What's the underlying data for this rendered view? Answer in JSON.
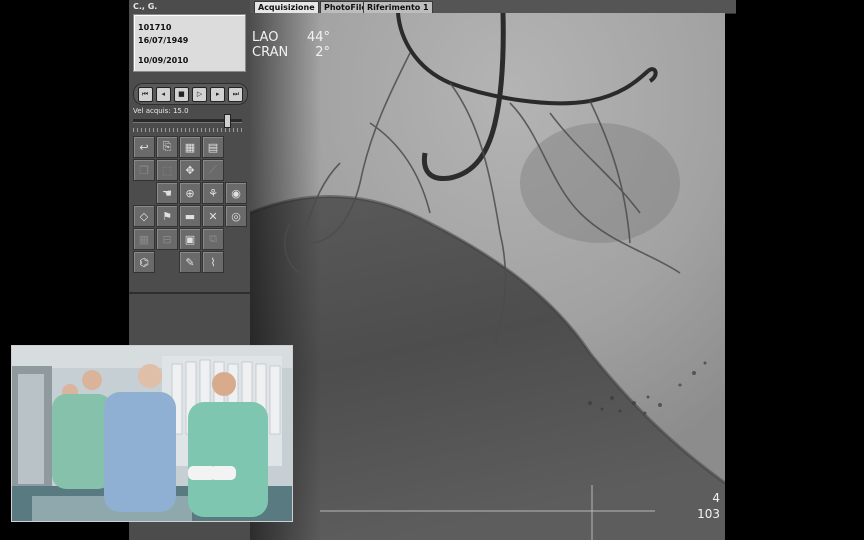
{
  "patient": {
    "name": "C., G.",
    "id": "101710",
    "dob": "16/07/1949",
    "exam_date": "10/09/2010"
  },
  "transport": {
    "buttons": [
      {
        "name": "skip-back-button",
        "icon": "skip-back-icon",
        "glyph": "⏮"
      },
      {
        "name": "step-back-button",
        "icon": "step-back-icon",
        "glyph": "◂"
      },
      {
        "name": "stop-button",
        "icon": "stop-icon",
        "glyph": "■"
      },
      {
        "name": "play-button",
        "icon": "play-icon",
        "glyph": "▷"
      },
      {
        "name": "step-forward-button",
        "icon": "step-forward-icon",
        "glyph": "▸"
      },
      {
        "name": "skip-forward-button",
        "icon": "skip-forward-icon",
        "glyph": "⏭"
      }
    ]
  },
  "speed": {
    "label": "Vel acquis:",
    "value": "15.0",
    "slider_fraction": 0.86
  },
  "tools": [
    {
      "name": "replay-tool-button",
      "icon": "replay-icon",
      "glyph": "↩",
      "dim": false
    },
    {
      "name": "open-folder-tool-button",
      "icon": "folder-open-icon",
      "glyph": "⎘",
      "dim": false
    },
    {
      "name": "film-strip-tool-button",
      "icon": "film-strip-icon",
      "glyph": "▦",
      "dim": false
    },
    {
      "name": "film-grid-tool-button",
      "icon": "film-grid-icon",
      "glyph": "▤",
      "dim": false
    },
    {
      "name": "empty-slot",
      "icon": "",
      "glyph": "",
      "dim": false,
      "empty": true
    },
    {
      "name": "copy-tool-button",
      "icon": "copy-icon",
      "glyph": "❐",
      "dim": true
    },
    {
      "name": "frame-select-tool-button",
      "icon": "frame-select-icon",
      "glyph": "⬚",
      "dim": true
    },
    {
      "name": "move-tool-button",
      "icon": "move-icon",
      "glyph": "✥",
      "dim": false
    },
    {
      "name": "measure-tool-button",
      "icon": "measure-icon",
      "glyph": "⟋",
      "dim": true
    },
    {
      "name": "empty-slot",
      "icon": "",
      "glyph": "",
      "dim": false,
      "empty": true
    },
    {
      "name": "empty-slot",
      "icon": "",
      "glyph": "",
      "dim": false,
      "empty": true
    },
    {
      "name": "hand-tool-button",
      "icon": "hand-icon",
      "glyph": "☚",
      "dim": false
    },
    {
      "name": "zoom-tool-button",
      "icon": "zoom-icon",
      "glyph": "⊕",
      "dim": false
    },
    {
      "name": "vessel-tool-button",
      "icon": "vessel-icon",
      "glyph": "⚘",
      "dim": false
    },
    {
      "name": "eye-tool-button",
      "icon": "eye-icon",
      "glyph": "◉",
      "dim": false
    },
    {
      "name": "calibrate-tool-button",
      "icon": "calibrate-icon",
      "glyph": "◇",
      "dim": false
    },
    {
      "name": "flag-tool-button",
      "icon": "flag-icon",
      "glyph": "⚑",
      "dim": false
    },
    {
      "name": "folder-tool-button",
      "icon": "folder-icon",
      "glyph": "▬",
      "dim": false
    },
    {
      "name": "close-tool-button",
      "icon": "close-icon",
      "glyph": "✕",
      "dim": false
    },
    {
      "name": "ref-eye-tool-button",
      "icon": "eye-ref-icon",
      "glyph": "◎",
      "dim": false
    },
    {
      "name": "grid-tool-button",
      "icon": "grid-icon",
      "glyph": "▦",
      "dim": true
    },
    {
      "name": "split-tool-button",
      "icon": "split-icon",
      "glyph": "⊟",
      "dim": true
    },
    {
      "name": "print-tool-button",
      "icon": "print-icon",
      "glyph": "▣",
      "dim": false
    },
    {
      "name": "compare-tool-button",
      "icon": "compare-icon",
      "glyph": "⧉",
      "dim": true
    },
    {
      "name": "empty-slot",
      "icon": "",
      "glyph": "",
      "dim": false,
      "empty": true
    },
    {
      "name": "satellite-tool-button",
      "icon": "satellite-icon",
      "glyph": "⌬",
      "dim": false
    },
    {
      "name": "empty-slot",
      "icon": "",
      "glyph": "",
      "dim": false,
      "empty": true
    },
    {
      "name": "pen-tool-button",
      "icon": "pen-icon",
      "glyph": "✎",
      "dim": false
    },
    {
      "name": "stent-tool-button",
      "icon": "stent-icon",
      "glyph": "⌇",
      "dim": false
    },
    {
      "name": "empty-slot",
      "icon": "",
      "glyph": "",
      "dim": false,
      "empty": true
    }
  ],
  "tabs": [
    {
      "label": "Acquisizione",
      "active": true
    },
    {
      "label": "PhotoFile",
      "active": false
    },
    {
      "label": "Riferimento 1",
      "active": false
    }
  ],
  "overlay": {
    "projection1_label": "LAO",
    "projection1_value": "44°",
    "projection2_label": "CRAN",
    "projection2_value": "2°",
    "frame": "4",
    "frame_total": "103"
  },
  "colors": {
    "panel_bg": "#4c4c4c",
    "angio_light": "#a7a7a7",
    "angio_dark": "#4a4a4a"
  }
}
